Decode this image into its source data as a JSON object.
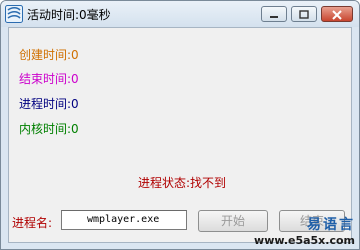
{
  "window": {
    "title": "活动时间:0毫秒",
    "icon": "app-icon"
  },
  "fields": {
    "created": "创建时间:0",
    "ended": "结束时间:0",
    "process_time": "进程时间:0",
    "kernel_time": "内核时间:0"
  },
  "status": {
    "label": "进程状态:",
    "value": "找不到"
  },
  "process": {
    "label": "进程名:",
    "value": "wmplayer.exe"
  },
  "buttons": {
    "start": "开始",
    "end": "结束"
  },
  "watermark": {
    "brand": "易语言",
    "url": "www.e5a5x.com"
  }
}
